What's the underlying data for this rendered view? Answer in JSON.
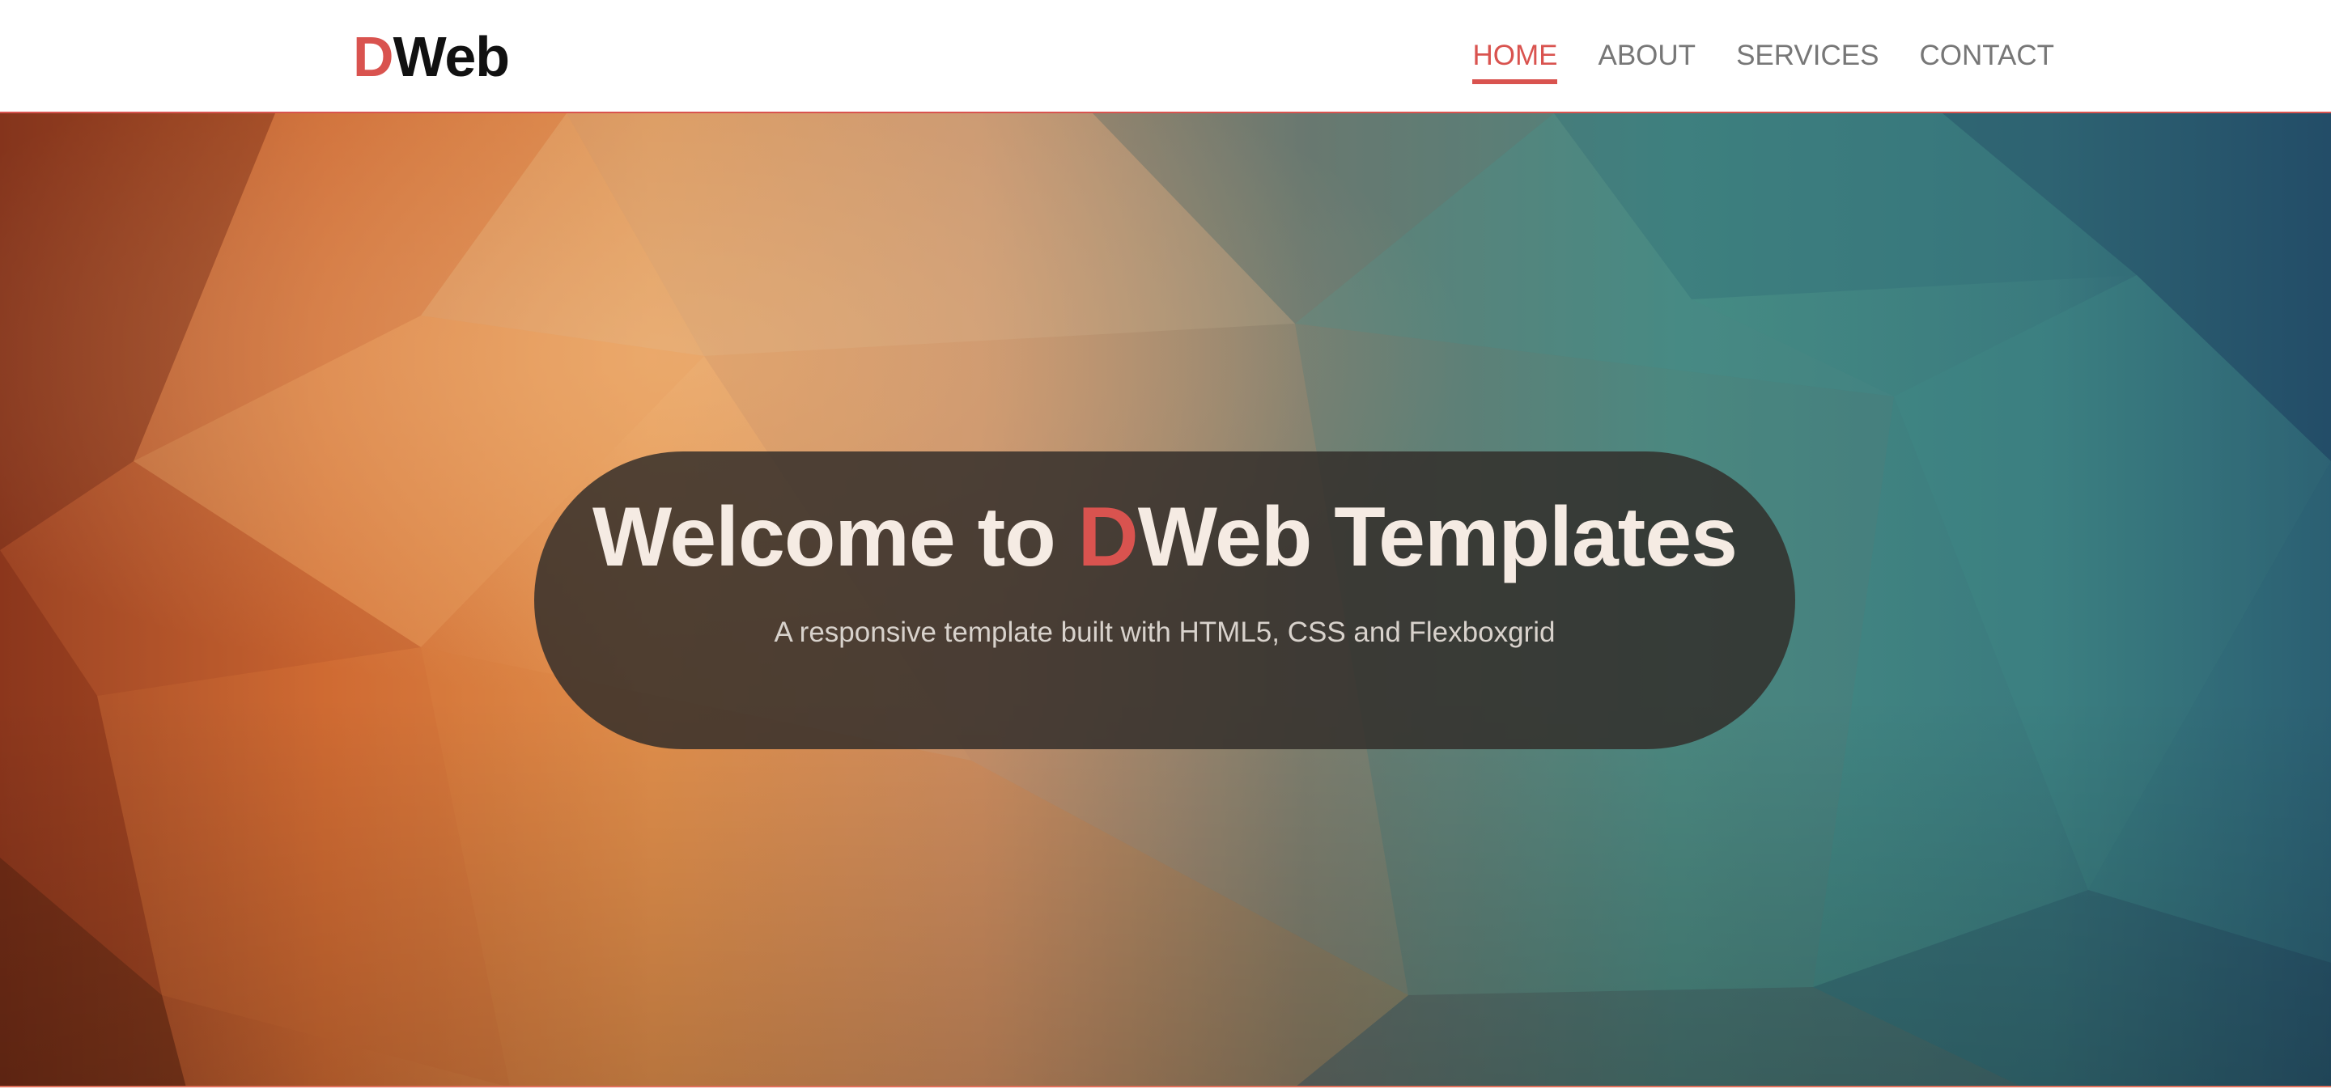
{
  "brand": {
    "accent_letter": "D",
    "rest": "Web",
    "accent_color": "#d9534f"
  },
  "nav": {
    "items": [
      {
        "label": "HOME",
        "active": true
      },
      {
        "label": "ABOUT",
        "active": false
      },
      {
        "label": "SERVICES",
        "active": false
      },
      {
        "label": "CONTACT",
        "active": false
      }
    ]
  },
  "hero": {
    "title_prefix": "Welcome to ",
    "title_accent": "D",
    "title_suffix": "Web Templates",
    "subtitle": "A responsive template built with HTML5, CSS and Flexboxgrid",
    "background": "low-poly orange-to-teal gradient"
  }
}
